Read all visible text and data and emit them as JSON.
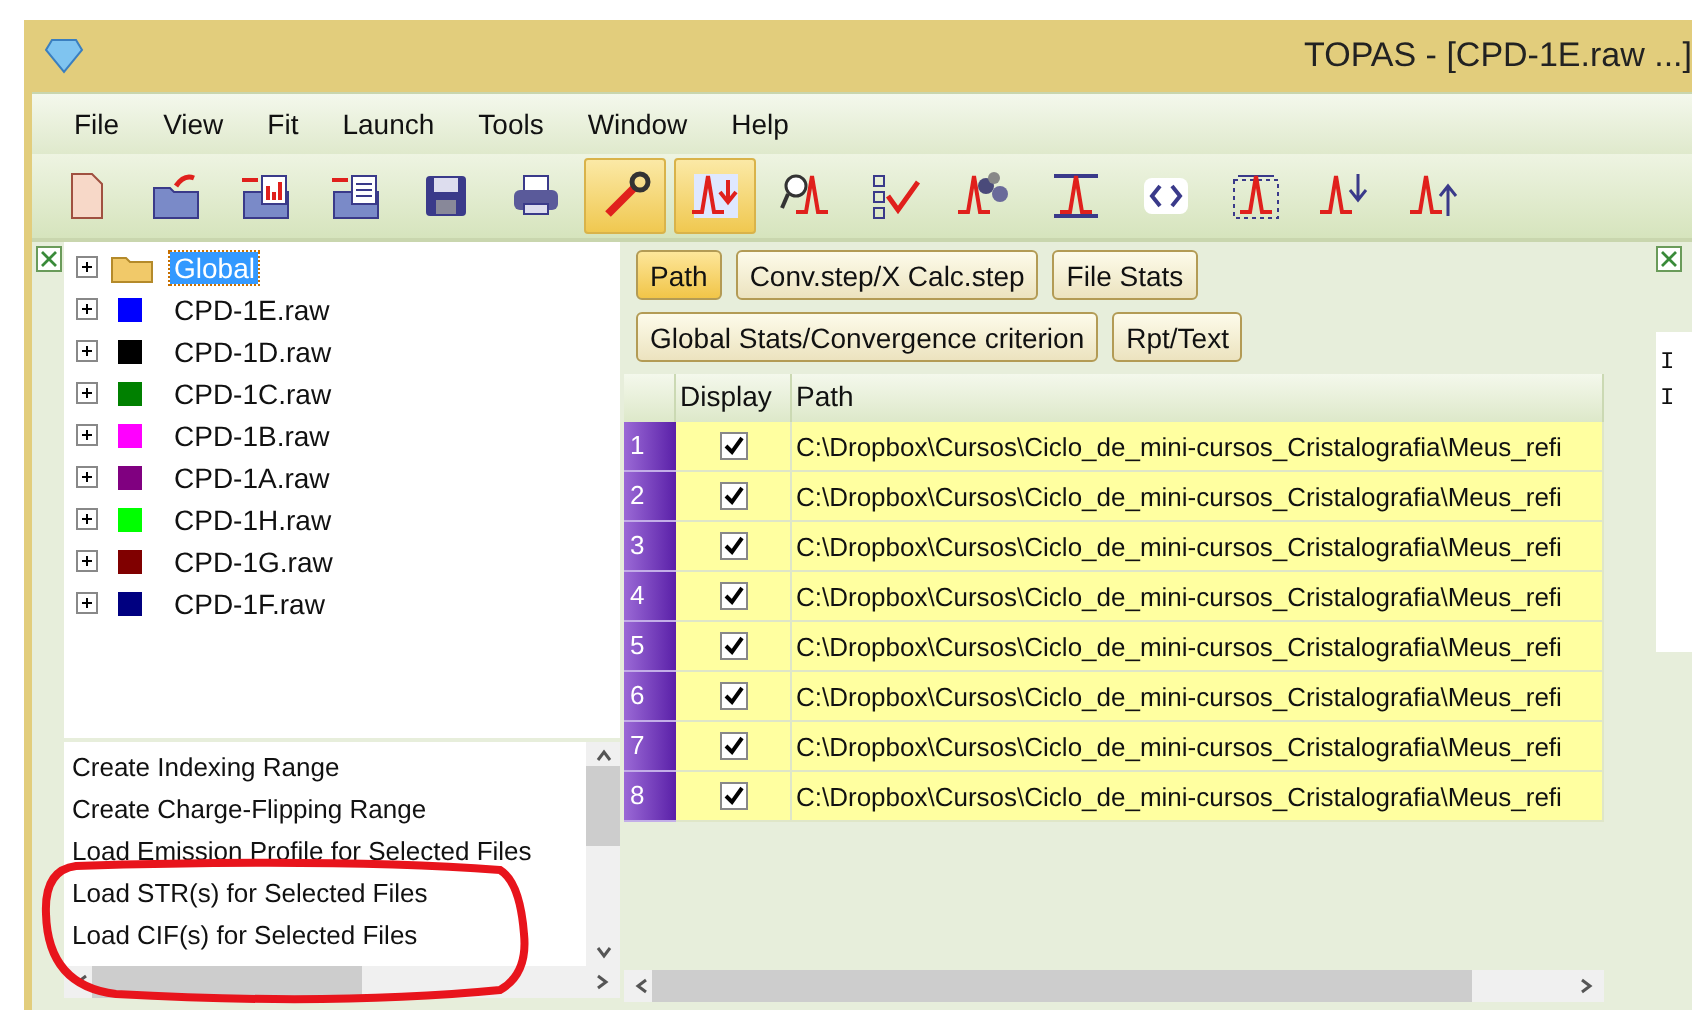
{
  "window": {
    "title": "TOPAS - [CPD-1E.raw ...]"
  },
  "menu": [
    "File",
    "View",
    "Fit",
    "Launch",
    "Tools",
    "Window",
    "Help"
  ],
  "toolbar": [
    {
      "selected": false
    },
    {
      "selected": false
    },
    {
      "selected": false
    },
    {
      "selected": false
    },
    {
      "selected": false
    },
    {
      "selected": false
    },
    {
      "selected": true
    },
    {
      "selected": true
    },
    {
      "selected": false
    },
    {
      "selected": false
    },
    {
      "selected": false
    },
    {
      "selected": false
    },
    {
      "selected": false
    },
    {
      "selected": false
    },
    {
      "selected": false
    },
    {
      "selected": false
    }
  ],
  "tree": [
    {
      "label": "Global",
      "selected": true,
      "kind": "folder"
    },
    {
      "label": "CPD-1E.raw",
      "selected": false,
      "kind": "file",
      "color": "#0000ff"
    },
    {
      "label": "CPD-1D.raw",
      "selected": false,
      "kind": "file",
      "color": "#000000"
    },
    {
      "label": "CPD-1C.raw",
      "selected": false,
      "kind": "file",
      "color": "#008000"
    },
    {
      "label": "CPD-1B.raw",
      "selected": false,
      "kind": "file",
      "color": "#ff00ff"
    },
    {
      "label": "CPD-1A.raw",
      "selected": false,
      "kind": "file",
      "color": "#800080"
    },
    {
      "label": "CPD-1H.raw",
      "selected": false,
      "kind": "file",
      "color": "#00ff00"
    },
    {
      "label": "CPD-1G.raw",
      "selected": false,
      "kind": "file",
      "color": "#800000"
    },
    {
      "label": "CPD-1F.raw",
      "selected": false,
      "kind": "file",
      "color": "#000080"
    }
  ],
  "commands": [
    "Create Indexing Range",
    "Create Charge-Flipping Range",
    "Load Emission Profile for Selected Files",
    "Load STR(s) for Selected Files",
    "Load CIF(s) for Selected Files"
  ],
  "view_buttons": [
    [
      {
        "label": "Path",
        "selected": true
      },
      {
        "label": "Conv.step/X Calc.step",
        "selected": false
      },
      {
        "label": "File Stats",
        "selected": false
      }
    ],
    [
      {
        "label": "Global Stats/Convergence criterion",
        "selected": false
      },
      {
        "label": "Rpt/Text",
        "selected": false
      }
    ]
  ],
  "table": {
    "columns": [
      "Display",
      "Path"
    ],
    "rows": [
      {
        "number": "1",
        "checked": true,
        "path": "C:\\Dropbox\\Cursos\\Ciclo_de_mini-cursos_Cristalografia\\Meus_refi"
      },
      {
        "number": "2",
        "checked": true,
        "path": "C:\\Dropbox\\Cursos\\Ciclo_de_mini-cursos_Cristalografia\\Meus_refi"
      },
      {
        "number": "3",
        "checked": true,
        "path": "C:\\Dropbox\\Cursos\\Ciclo_de_mini-cursos_Cristalografia\\Meus_refi"
      },
      {
        "number": "4",
        "checked": true,
        "path": "C:\\Dropbox\\Cursos\\Ciclo_de_mini-cursos_Cristalografia\\Meus_refi"
      },
      {
        "number": "5",
        "checked": true,
        "path": "C:\\Dropbox\\Cursos\\Ciclo_de_mini-cursos_Cristalografia\\Meus_refi"
      },
      {
        "number": "6",
        "checked": true,
        "path": "C:\\Dropbox\\Cursos\\Ciclo_de_mini-cursos_Cristalografia\\Meus_refi"
      },
      {
        "number": "7",
        "checked": true,
        "path": "C:\\Dropbox\\Cursos\\Ciclo_de_mini-cursos_Cristalografia\\Meus_refi"
      },
      {
        "number": "8",
        "checked": true,
        "path": "C:\\Dropbox\\Cursos\\Ciclo_de_mini-cursos_Cristalografia\\Meus_refi"
      }
    ]
  },
  "side_panel": {
    "lines": [
      "I",
      "I"
    ]
  }
}
